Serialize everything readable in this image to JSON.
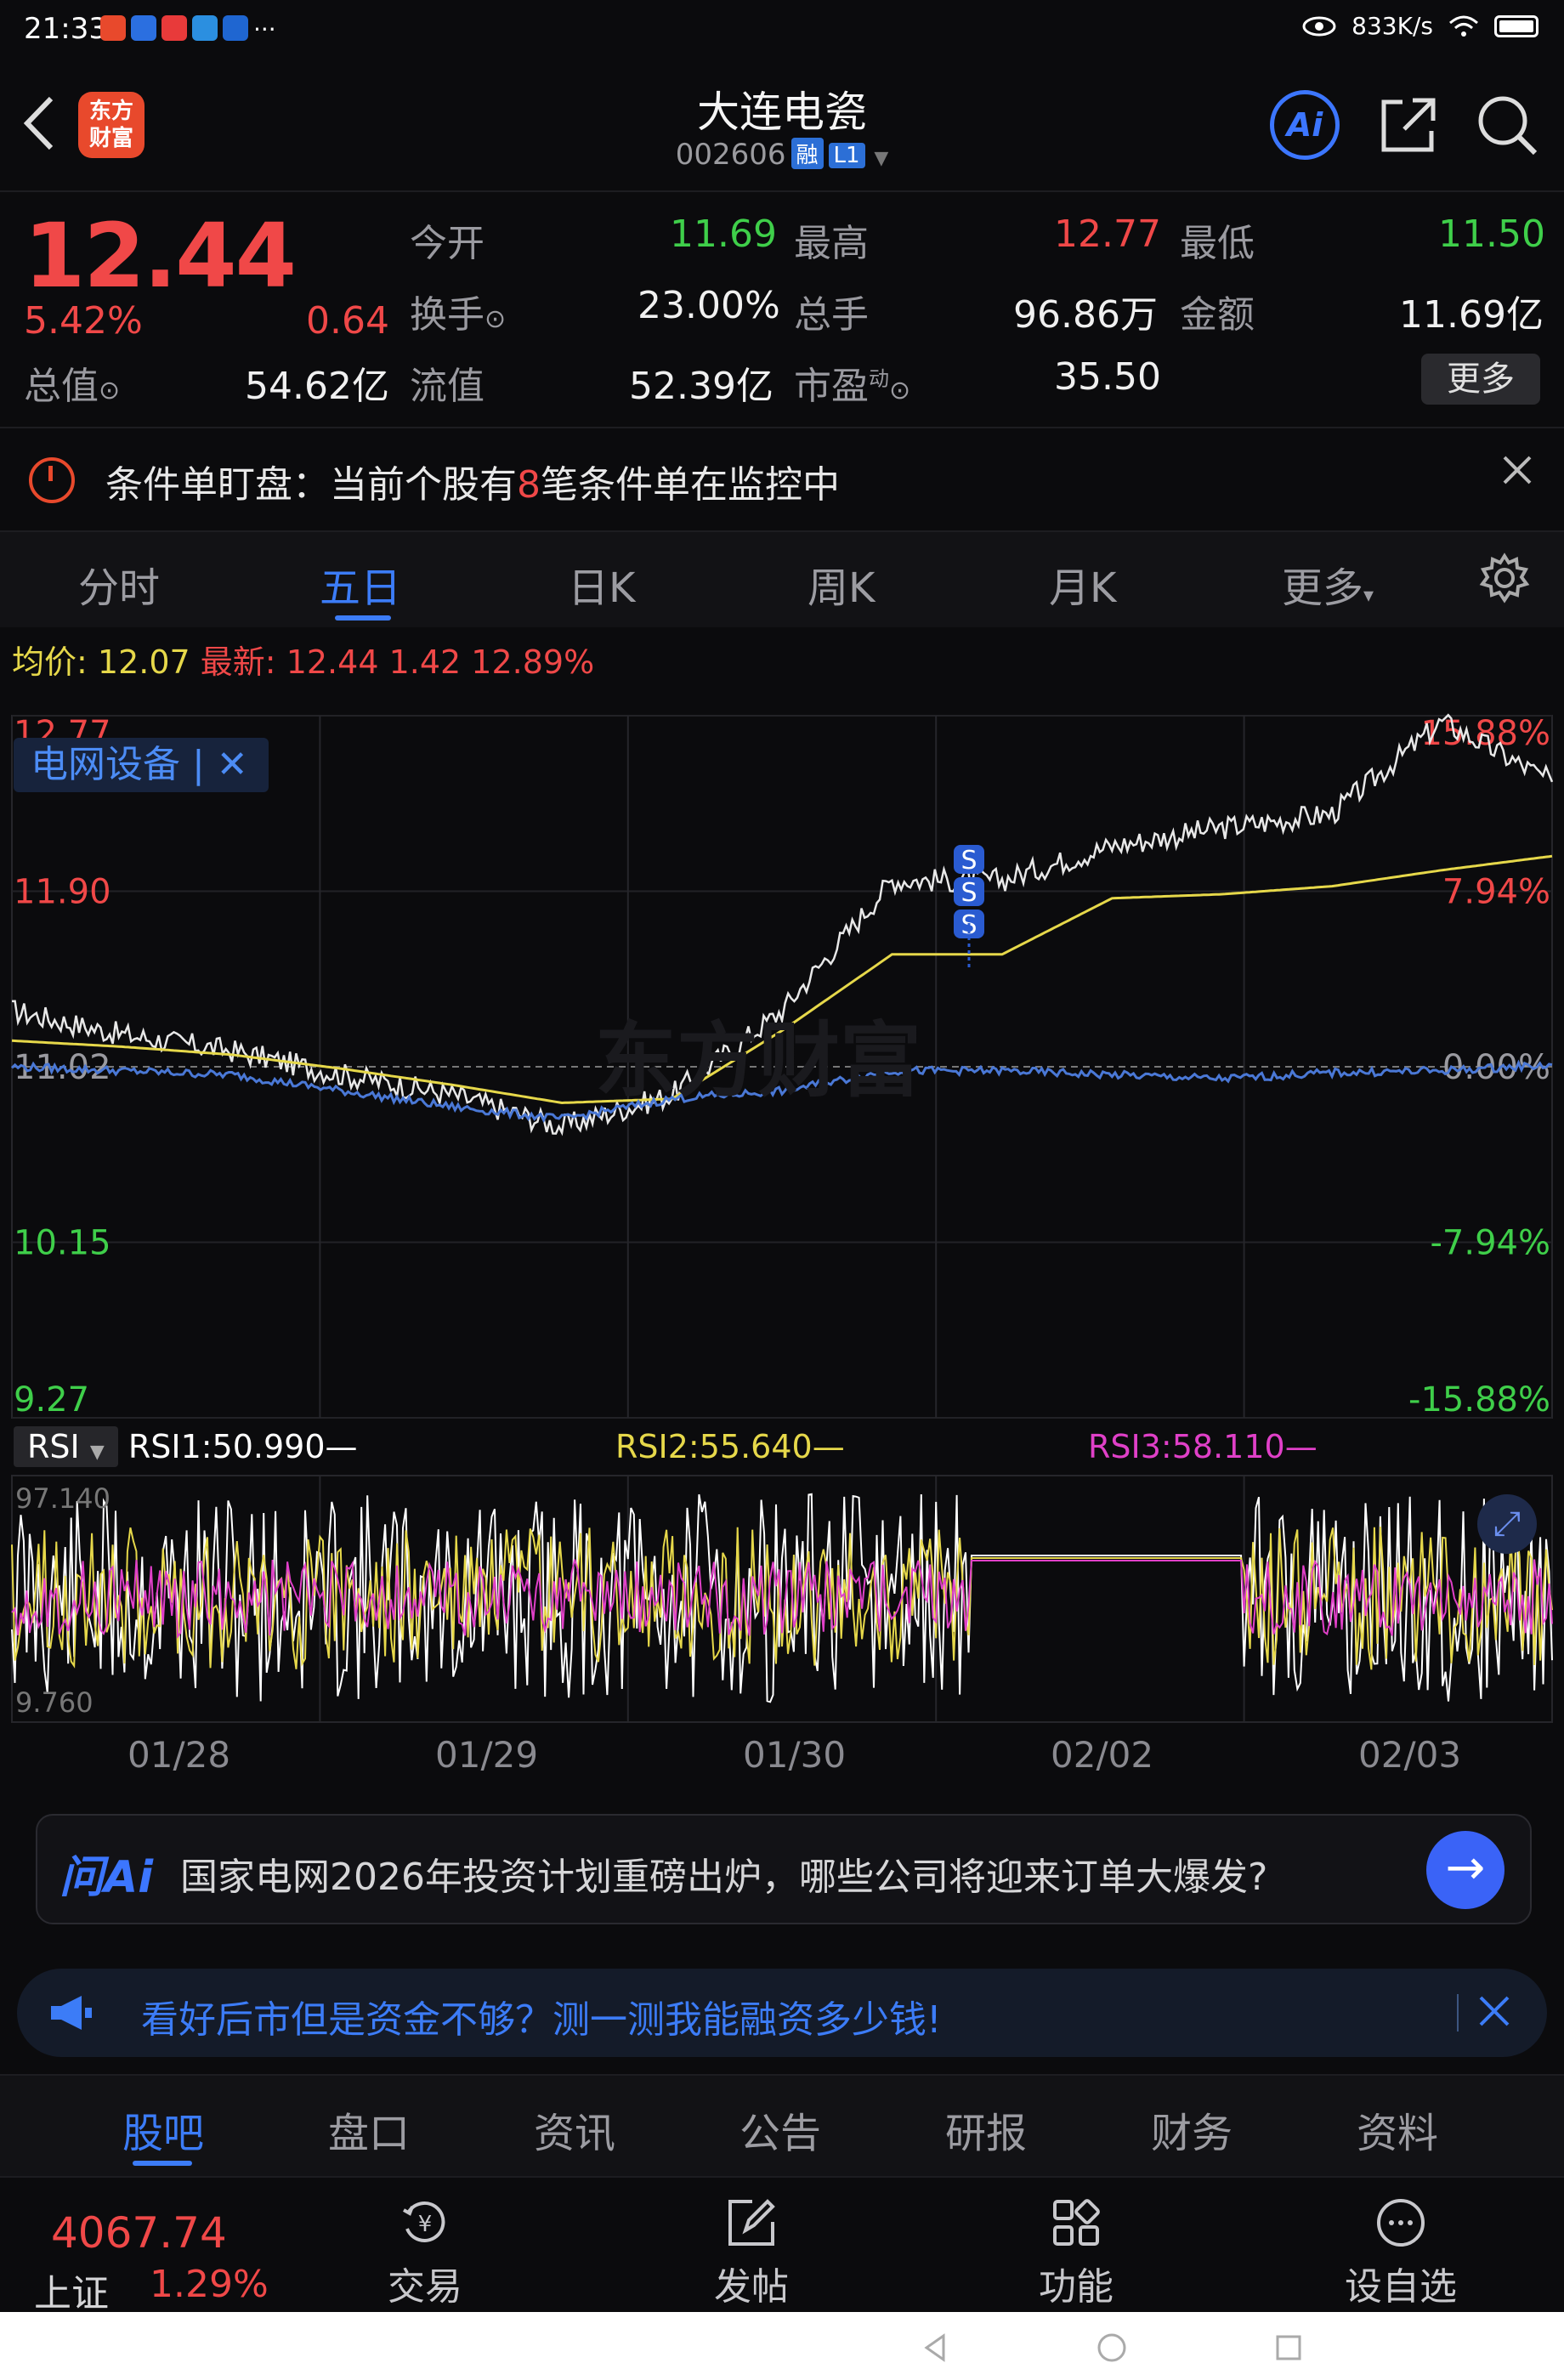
{
  "status_bar": {
    "time": "21:33",
    "speed": "833K/s",
    "more": "···"
  },
  "header": {
    "back_icon": "chevron-left-icon",
    "logo_line1": "东方",
    "logo_line2": "财富",
    "stock_name": "大连电瓷",
    "stock_code": "002606",
    "badge_margin": "融",
    "badge_level": "L1",
    "ai_label": "Ai"
  },
  "quote": {
    "price": "12.44",
    "change_pct": "5.42%",
    "change": "0.64",
    "rows": [
      [
        {
          "label": "今开",
          "value": "11.69",
          "color": "green"
        },
        {
          "label": "最高",
          "value": "12.77",
          "color": "red"
        },
        {
          "label": "最低",
          "value": "11.50",
          "color": "green"
        }
      ],
      [
        {
          "label": "换手",
          "value": "23.00%",
          "color": "white"
        },
        {
          "label": "总手",
          "value": "96.86万",
          "color": "white"
        },
        {
          "label": "金额",
          "value": "11.69亿",
          "color": "white"
        }
      ]
    ],
    "total_value_label": "总值",
    "total_value": "54.62亿",
    "float_label": "流值",
    "float_value": "52.39亿",
    "pe_label": "市盈",
    "pe_super": "动",
    "pe_value": "35.50",
    "more_button": "更多"
  },
  "alert": {
    "text_before": "条件单盯盘：当前个股有",
    "count": "8",
    "text_after": "笔条件单在监控中"
  },
  "chart_tabs": [
    "分时",
    "五日",
    "日K",
    "周K",
    "月K",
    "更多"
  ],
  "chart_tab_active": 1,
  "chart_header": {
    "avg_label": "均价:",
    "avg_value": "12.07",
    "latest_label": "最新:",
    "latest_value": "12.44",
    "latest_change": "1.42",
    "latest_pct": "12.89%",
    "sector_tag": "电网设备",
    "watermark": "东方财富"
  },
  "chart_data": {
    "type": "line",
    "x": [
      "01/28",
      "01/29",
      "01/30",
      "02/02",
      "02/03"
    ],
    "y_ticks_left": [
      "12.77",
      "11.90",
      "11.02",
      "10.15",
      "9.27"
    ],
    "y_ticks_right": [
      "15.88%",
      "7.94%",
      "0.00%",
      "-7.94%",
      "-15.88%"
    ],
    "ylim": [
      9.27,
      12.77
    ],
    "reference_price": 11.02,
    "series": [
      {
        "name": "price",
        "color": "#e8e8e8",
        "values": [
          11.3,
          11.18,
          11.1,
          10.98,
          10.88,
          10.72,
          10.88,
          11.3,
          11.95,
          11.95,
          12.12,
          12.21,
          12.28,
          12.74,
          12.44
        ]
      },
      {
        "name": "avg",
        "color": "#e6d84a",
        "values": [
          11.15,
          11.12,
          11.08,
          11.01,
          10.93,
          10.84,
          10.86,
          11.2,
          11.58,
          11.58,
          11.86,
          11.88,
          11.92,
          12.0,
          12.07
        ]
      },
      {
        "name": "index",
        "color": "#4a78d6",
        "values": [
          11.02,
          11.0,
          10.98,
          10.9,
          10.82,
          10.76,
          10.86,
          10.9,
          11.0,
          11.0,
          10.98,
          10.96,
          10.99,
          11.0,
          11.03
        ]
      }
    ],
    "signals": [
      "S",
      "S",
      "S"
    ]
  },
  "rsi": {
    "selector": "RSI",
    "rsi1": "RSI1:50.990",
    "rsi2": "RSI2:55.640",
    "rsi3": "RSI3:58.110",
    "max": "97.140",
    "min": "9.760",
    "colors": {
      "rsi1": "#ffffff",
      "rsi2": "#e6d84a",
      "rsi3": "#e040c8"
    }
  },
  "ask_ai": {
    "logo": "问Ai",
    "question": "国家电网2026年投资计划重磅出炉，哪些公司将迎来订单大爆发?"
  },
  "promo": {
    "text": "看好后市但是资金不够？测一测我能融资多少钱!"
  },
  "info_tabs": [
    "股吧",
    "盘口",
    "资讯",
    "公告",
    "研报",
    "财务",
    "资料"
  ],
  "info_tab_active": 0,
  "bottom_nav": {
    "index_value": "4067.74",
    "index_name": "上证",
    "index_pct": "1.29%",
    "items": [
      {
        "label": "交易",
        "icon": "trade-icon"
      },
      {
        "label": "发帖",
        "icon": "edit-icon"
      },
      {
        "label": "功能",
        "icon": "grid-icon"
      },
      {
        "label": "设自选",
        "icon": "add-watchlist-icon"
      }
    ]
  },
  "colors": {
    "up": "#f04848",
    "down": "#3fcf4a",
    "accent": "#3c7cf7",
    "background": "#0b0b0d"
  }
}
